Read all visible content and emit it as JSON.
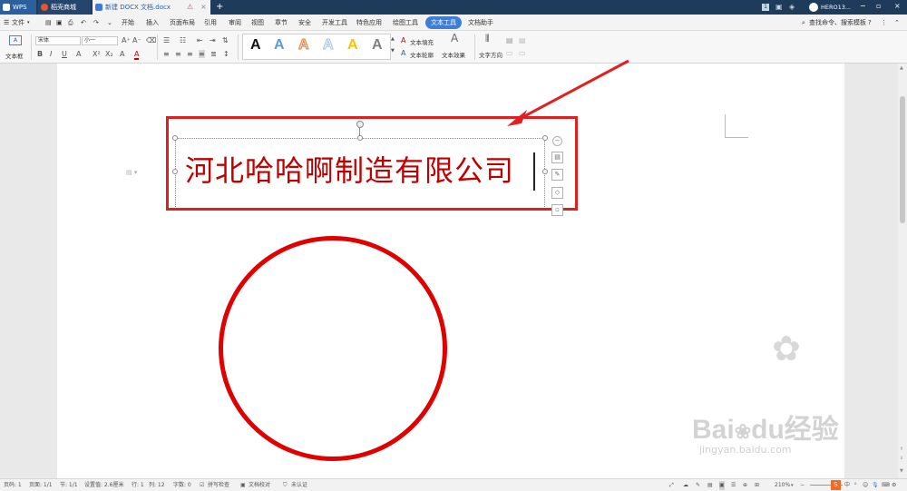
{
  "tabs": [
    {
      "label": "WPS"
    },
    {
      "label": "稻壳商城"
    },
    {
      "label": "新建 DOCX 文档.docx"
    }
  ],
  "title_bar": {
    "user": "HERO13..."
  },
  "menu": {
    "file": "文件",
    "items": [
      "开始",
      "插入",
      "页面布局",
      "引用",
      "审阅",
      "视图",
      "章节",
      "安全",
      "开发工具",
      "特色应用",
      "绘图工具",
      "文本工具",
      "文档助手"
    ],
    "active": "文本工具",
    "search_placeholder": "查找命令、搜索模板"
  },
  "ribbon": {
    "textbox_label": "文本框",
    "font_name": "宋体",
    "font_size": "小一",
    "text_fill": "文本填充",
    "text_outline": "文本轮廓",
    "text_effect": "文本效果",
    "text_direction": "文字方向",
    "text_styles": [
      {
        "letter": "A",
        "color": "#111111"
      },
      {
        "letter": "A",
        "color": "#5b9bd5"
      },
      {
        "letter": "A",
        "color": "#ed7d31"
      },
      {
        "letter": "A",
        "color": "#9dc3e6"
      },
      {
        "letter": "A",
        "color": "#ffc000"
      },
      {
        "letter": "A",
        "color": "#7f7f7f"
      }
    ]
  },
  "document": {
    "text": "河北哈哈啊制造有限公司",
    "text_color": "#c00000",
    "highlight_color": "#e02020",
    "circle_color": "#e00000"
  },
  "status": {
    "page_num": "页码: 1",
    "pages": "页面: 1/1",
    "section": "节: 1/1",
    "setting": "设置值: 2.6厘米",
    "row": "行: 1",
    "col": "列: 12",
    "word_count": "字数: 0",
    "spell_check": "拼写检查",
    "doc_check": "文档校对",
    "cert": "未认证",
    "zoom": "210%"
  },
  "watermark": {
    "brand": "Bai",
    "brand2": "du",
    "suffix": "经验",
    "url": "jingyan.baidu.com"
  }
}
